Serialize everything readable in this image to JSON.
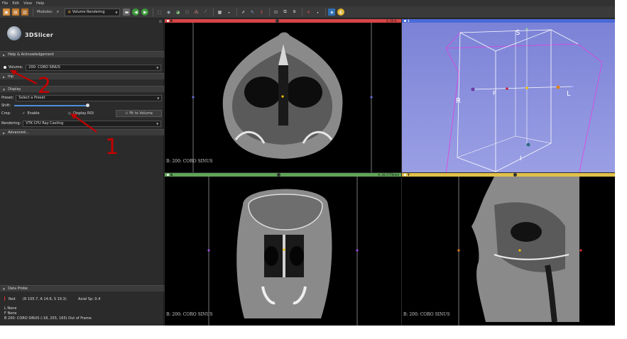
{
  "menu": {
    "file": "File",
    "edit": "Edit",
    "view": "View",
    "help": "Help"
  },
  "toolbar": {
    "modules_label": "Modules:",
    "module_selected": "Volume Rendering"
  },
  "panel": {
    "logo_text": "3DSlicer",
    "close_label": "⊠",
    "help_section": "Help & Acknowledgement",
    "volume_label": "Volume:",
    "volume_value": "200: CORO SINUS",
    "inputs_section": "Inp",
    "display_section": "Display",
    "preset_label": "Preset:",
    "preset_value": "Select a Preset",
    "shift_label": "Shift:",
    "crop_label": "Crop:",
    "enable_label": "Enable",
    "display_roi_label": "Display ROI",
    "fit_button": "Fit to Volume",
    "rendering_label": "Rendering:",
    "rendering_value": "VTK CPU Ray Casting",
    "advanced_section": "Advanced...",
    "data_probe_section": "Data Probe"
  },
  "annotations": {
    "one": "1",
    "two": "2"
  },
  "probe": {
    "view": "Red",
    "ras": "(R 105.7, A 14.6, S 19.3)",
    "orientation": "Axial Sp: 0.4",
    "line1": "L None",
    "line2": "F None",
    "line3": "B 200: CORO SINUS (-18, 255, 165) Out of Frame"
  },
  "views": {
    "red": {
      "label": "R",
      "offset": "S: 20.6...",
      "corner": "B: 200: CORO SINUS",
      "color": "#d64545"
    },
    "green": {
      "label": "G",
      "offset": "A: 26.7776mm",
      "corner": "B: 200: CORO SINUS",
      "color": "#5fa357"
    },
    "yellow": {
      "label": "Y",
      "corner": "B: 200: CORO SINUS",
      "color": "#e0c04a"
    },
    "threeD": {
      "label": "1",
      "orient_s": "S",
      "orient_r": "R",
      "orient_l": "L",
      "orient_p": "P",
      "orient_i": "I",
      "color": "#4a6ad8"
    }
  }
}
